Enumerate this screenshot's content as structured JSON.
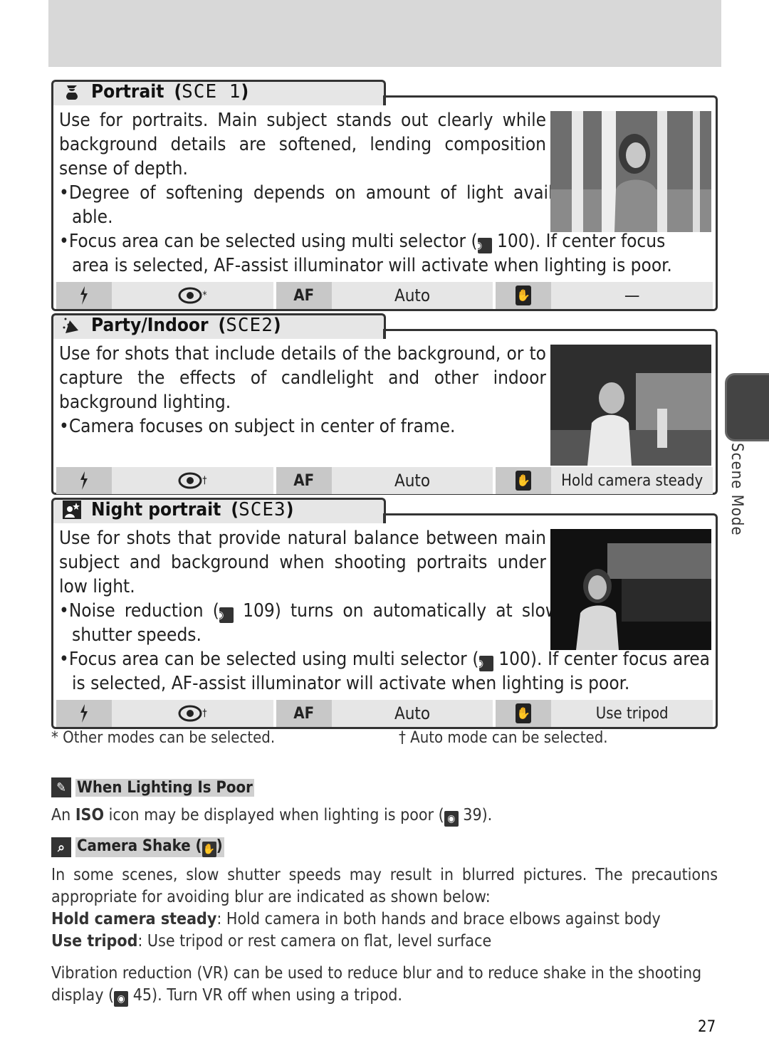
{
  "sections": [
    {
      "title": "Portrait",
      "code": "SCE 1",
      "body": [
        "Use for portraits.  Main subject stands out clearly while background details are softened, lending composition sense of depth."
      ],
      "bullets": [
        "Degree of softening depends on amount of light avail- able.",
        "Focus area can be selected using multi selector (",
        "area is selected, AF-assist illuminator will activate when lighting is poor."
      ],
      "bullet2_ref": "100",
      "bullet2_tail": ").  If center focus",
      "photo_alt": "Woman standing among birch trees",
      "table": {
        "flash_mark": "*",
        "focus": "Auto",
        "shake": "—"
      }
    },
    {
      "title": "Party/Indoor",
      "code": "SCE2",
      "body": [
        "Use for shots that include details of the background, or to capture the effects of candlelight and other indoor background lighting."
      ],
      "bullets": [
        "Camera focuses on subject in center of frame."
      ],
      "photo_alt": "Woman standing at a bar counter",
      "table": {
        "flash_mark": "†",
        "focus": "Auto",
        "shake": "Hold camera steady"
      }
    },
    {
      "title": "Night portrait",
      "code": "SCE3",
      "body": [
        "Use for shots that provide natural balance between main subject and background when shooting portraits under low light."
      ],
      "bullet1_pre": "Noise reduction (",
      "bullet1_ref": "109",
      "bullet1_post": ") turns on automatically at slow shutter speeds.",
      "bullet2_pre": "Focus area can be selected using multi selector (",
      "bullet2_ref": "100",
      "bullet2_post": ").  If center focus area is selected, AF-assist illuminator will activate when lighting is poor.",
      "photo_alt": "Woman by a canal at night",
      "table": {
        "flash_mark": "†",
        "focus": "Auto",
        "shake": "Use tripod"
      }
    }
  ],
  "table_af_label": "AF",
  "footnotes": {
    "star": "* Other modes can be selected.",
    "dagger": "† Auto mode can be selected."
  },
  "notes": {
    "lighting": {
      "heading": "When Lighting Is Poor",
      "pre": "An ",
      "bold": "ISO",
      "post": " icon may be displayed when lighting is poor (",
      "ref": "39",
      "end": ")."
    },
    "shake": {
      "heading": "Camera Shake (",
      "heading_end": ")",
      "intro": "In some scenes, slow shutter speeds may result in blurred pictures.  The precautions appropriate for avoiding blur are indicated as shown below:",
      "steady_term": "Hold camera steady",
      "steady_def": ": Hold camera in both hands and brace elbows against body",
      "tripod_term": "Use tripod",
      "tripod_def": ": Use tripod or rest camera on flat, level surface",
      "vr_pre": "Vibration reduction (VR) can be used to reduce blur and to reduce shake in the shooting display (",
      "vr_ref": "45",
      "vr_post": ").  Turn VR off when using a tripod."
    }
  },
  "side_label": "Scene Mode",
  "page_number": "27"
}
